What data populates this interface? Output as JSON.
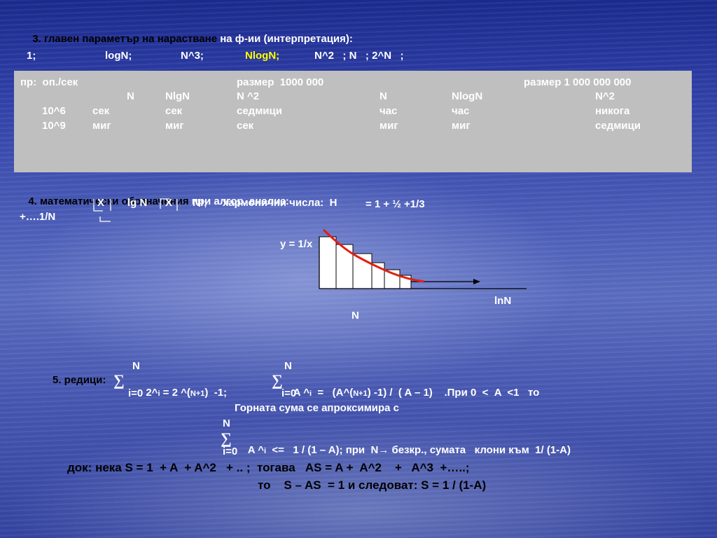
{
  "sec3": {
    "title_black": "3. главен параметър на нарастване",
    "title_white": " на ф-ии (интерпретация):",
    "row": [
      "1;",
      "logN;",
      "N^3;",
      "NlogN;",
      "N^2   ; N   ; 2^N   ;"
    ]
  },
  "table": {
    "label": "пр:  оп./сек",
    "size1": "размер  1000 000",
    "size2": "размер 1 000 000 000",
    "headers": [
      "N",
      "NlgN",
      "N ^2",
      "N",
      "NlogN",
      "N^2"
    ],
    "rows": [
      [
        "10^6",
        "сек",
        "сек",
        "седмици",
        "час",
        "час",
        "никога"
      ],
      [
        "10^9",
        "миг",
        "миг",
        "сек",
        "миг",
        "миг",
        "седмици"
      ]
    ]
  },
  "sec4": {
    "title_black": "4. математически обозначения",
    "title_white": " при алгор. анализ:",
    "line1": [
      "X",
      "lg N",
      "X",
      "N!;",
      "хармонични числа:  H",
      "= 1 + ½ +1/3"
    ],
    "line2": "+….1/N",
    "y_label": "y = 1/x",
    "lnn_label": "lnN",
    "n_label": "N"
  },
  "sec5": {
    "n1": "N",
    "n2": "N",
    "prefix": "5. редици:",
    "sum1": "2^",
    "sub_i1": "i",
    "eq1": " = 2 ^(",
    "np1_a": "N+1",
    "eq1b": ")  -1;",
    "sum2": "A ^",
    "sub_i2": "i",
    "eq2": "  =   (A^(",
    "np1_b": "N+1",
    "eq2b": ") -1) /  ( A – 1)    .При 0  <  A  <1   то",
    "i0_a": "i=0",
    "i0_b": "i=0",
    "approx": "Горната сума се апроксимира с",
    "n3": "N",
    "sum3": "A ^",
    "sub_i3": "i",
    "eq3": "  <=   1 / (1 – A); при  N",
    "arrow": "→",
    "eq3b": " безкр., сумата   клони към  1/ (1-A)",
    "i0_c": "i=0"
  },
  "proof": {
    "line1": "док: нека S = 1  + A  + A^2   + .. ;  тогава   AS = A +  A^2    +   A^3  +…..;",
    "line2": "то    S – AS  = 1 и следоват: S = 1 / (1-A)"
  },
  "chart_data": {
    "type": "diagram",
    "curve": "y = 1/x",
    "bars": 6
  }
}
